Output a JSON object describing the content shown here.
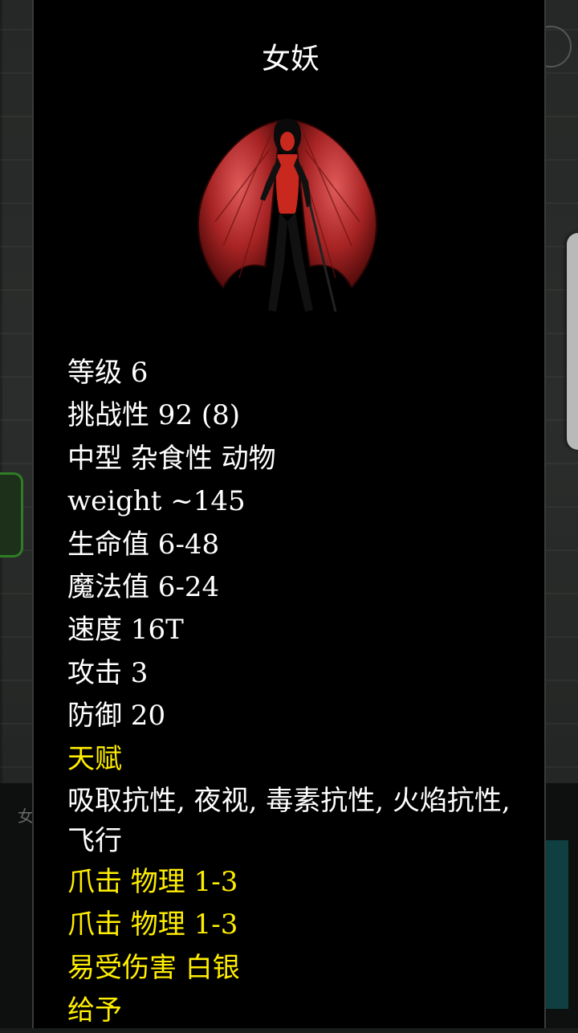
{
  "background": {
    "left_fragment": "女"
  },
  "monster": {
    "name": "女妖",
    "level": "等级 6",
    "challenge": "挑战性 92 (8)",
    "size_type": "中型 杂食性 动物",
    "weight": "weight ~145",
    "hp": "生命值 6-48",
    "mp": "魔法值 6-24",
    "speed": "速度 16T",
    "attack": "攻击 3",
    "defense": "防御 20",
    "talent_header": "天赋",
    "talents": "吸取抗性, 夜视, 毒素抗性, 火焰抗性, 飞行",
    "attack_1": "爪击 物理 1-3",
    "attack_2": "爪击 物理 1-3",
    "vulnerability": "易受伤害 白银",
    "grants_header": "给予"
  },
  "colors": {
    "dialog_bg": "#000000",
    "text": "#ffffff",
    "highlight": "#ffee00",
    "wing_red": "#b22a2a",
    "body_red": "#c8281e"
  }
}
